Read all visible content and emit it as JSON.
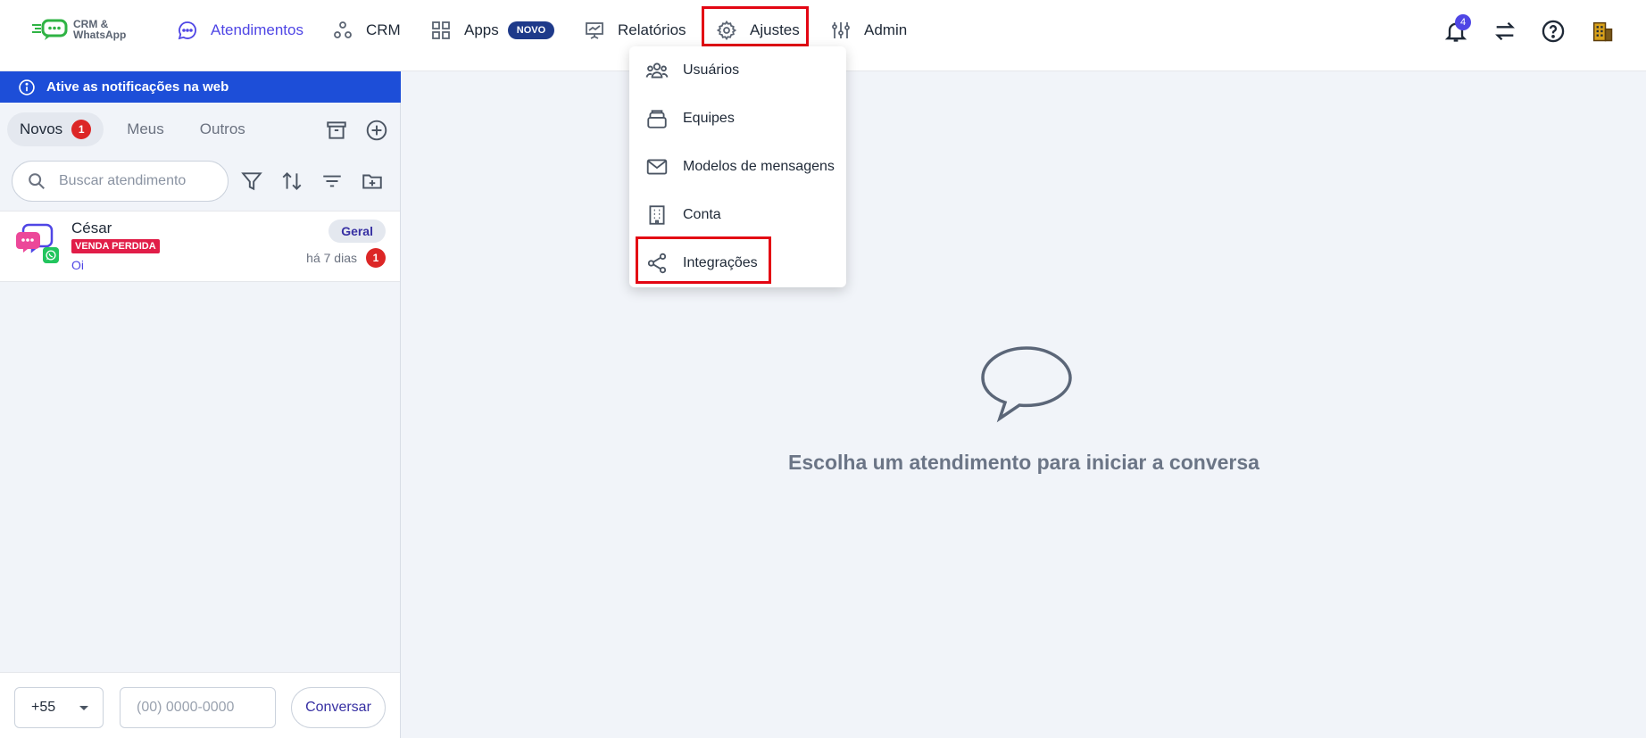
{
  "app": {
    "logo_line1": "CRM &",
    "logo_line2": "WhatsApp"
  },
  "nav": {
    "atendimentos": "Atendimentos",
    "crm": "CRM",
    "apps": "Apps",
    "apps_badge": "NOVO",
    "relatorios": "Relatórios",
    "ajustes": "Ajustes",
    "admin": "Admin",
    "notifications_count": "4"
  },
  "banner": {
    "text": "Ative as notificações na web"
  },
  "tabs": [
    {
      "label": "Novos",
      "count": "1",
      "active": true
    },
    {
      "label": "Meus"
    },
    {
      "label": "Outros"
    }
  ],
  "search": {
    "placeholder": "Buscar atendimento"
  },
  "conversation": {
    "name": "César",
    "tag": "VENDA PERDIDA",
    "message": "Oi",
    "queue": "Geral",
    "time": "há 7 dias",
    "unread": "1"
  },
  "start": {
    "ddi": "+55",
    "phone_placeholder": "(00) 0000-0000",
    "button": "Conversar"
  },
  "main": {
    "empty_text": "Escolha um atendimento para iniciar a conversa"
  },
  "settings_menu": {
    "items": [
      {
        "label": "Usuários",
        "icon": "users-icon"
      },
      {
        "label": "Equipes",
        "icon": "teams-icon"
      },
      {
        "label": "Modelos de mensagens",
        "icon": "mail-icon"
      },
      {
        "label": "Conta",
        "icon": "building-icon"
      },
      {
        "label": "Integrações",
        "icon": "share-icon"
      }
    ]
  },
  "colors": {
    "accent": "#4f46e5",
    "banner": "#1d4ed8",
    "badge_red": "#dc2626",
    "highlight": "#e30613"
  }
}
